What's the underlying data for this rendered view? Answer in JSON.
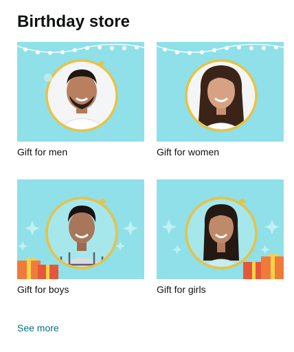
{
  "widget": {
    "title": "Birthday store",
    "see_more": "See more",
    "tiles": [
      {
        "label": "Gift for men"
      },
      {
        "label": "Gift for women"
      },
      {
        "label": "Gift for boys"
      },
      {
        "label": "Gift for girls"
      }
    ]
  },
  "colors": {
    "tile_background": "#8fe0e8",
    "ring_gold": "#e8c245",
    "link": "#007185"
  }
}
